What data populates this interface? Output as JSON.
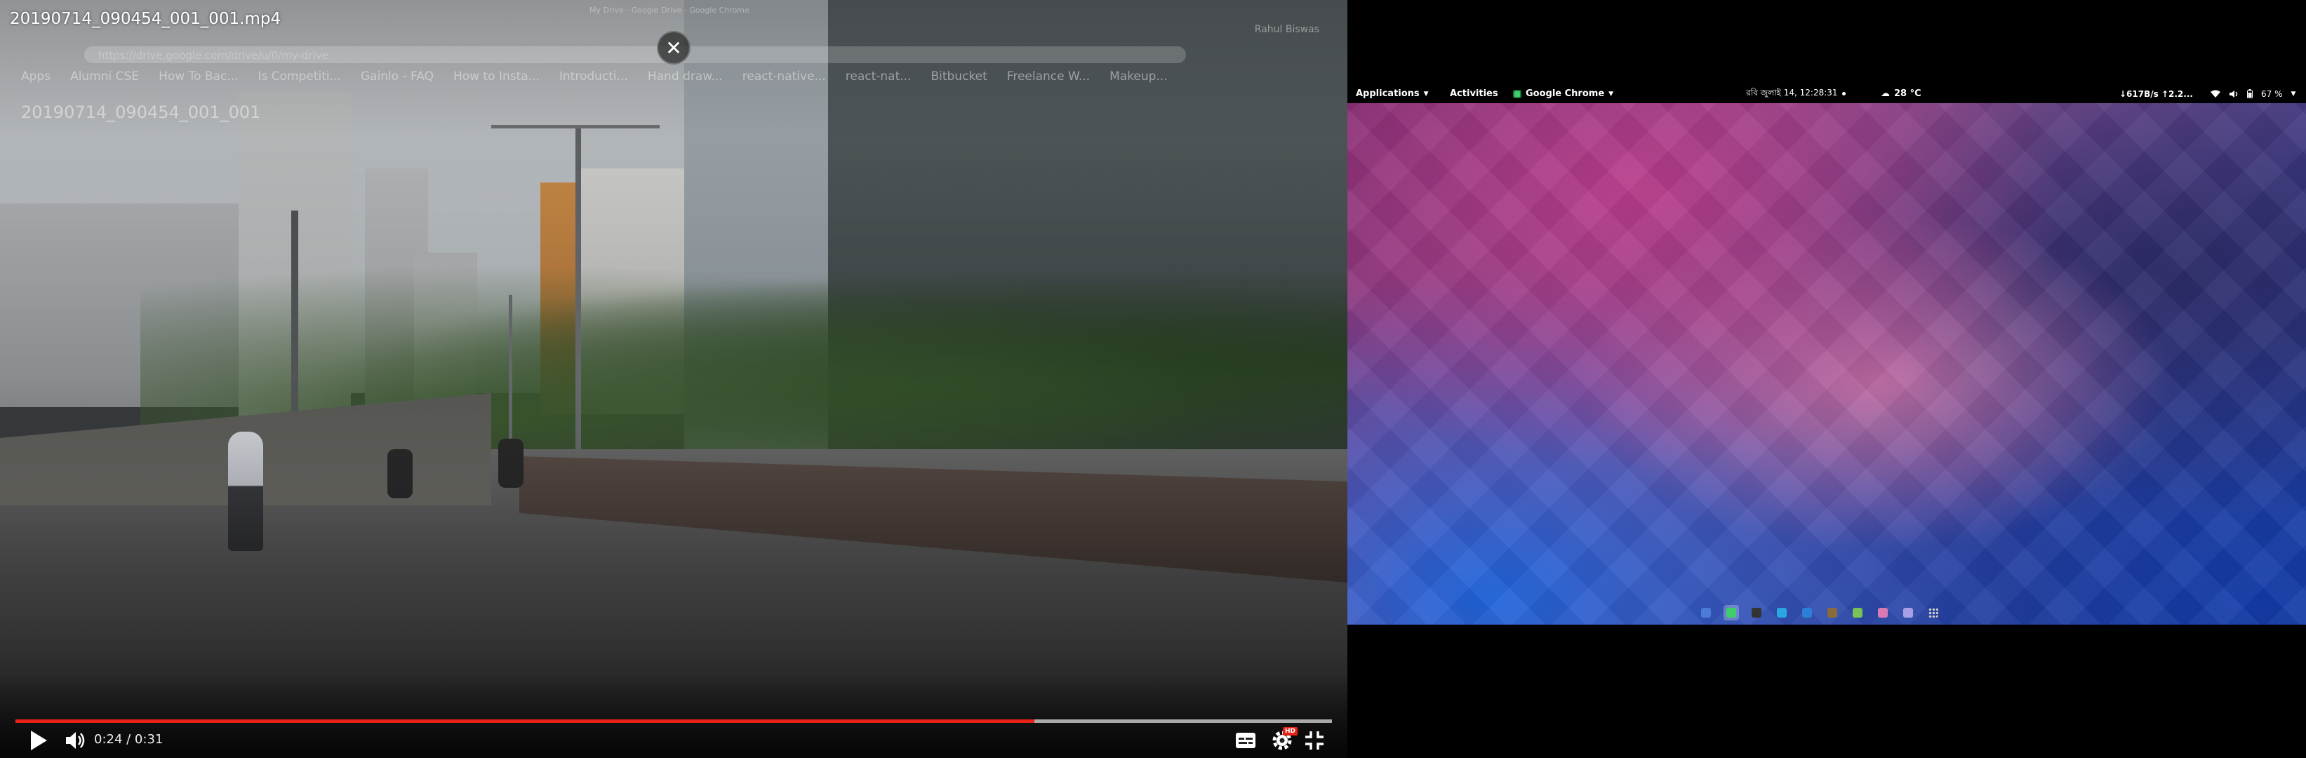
{
  "video_player": {
    "title": "20190714_090454_001_001.mp4",
    "close_glyph": "✕",
    "time_display": "0:24 / 0:31",
    "progress_fraction": 0.7742,
    "buffered_fraction": 1.0,
    "hd_badge": "HD",
    "colors": {
      "progress": "#e62117",
      "track": "rgba(255,255,255,0.35)"
    },
    "icons": [
      "play-icon",
      "volume-icon",
      "captions-icon",
      "settings-icon",
      "exit-fullscreen-icon"
    ]
  },
  "ghost_browser": {
    "tab_text": "My Drive - Google Drive - Google Chrome",
    "user": "Rahul Biswas",
    "url": "https://drive.google.com/drive/u/0/my-drive",
    "bookmarks": [
      "Apps",
      "Alumni CSE",
      "How To Bac...",
      "Is Competiti...",
      "Gainlo - FAQ",
      "How to Insta...",
      "Introducti...",
      "Hand draw...",
      "react-native...",
      "react-nat...",
      "Bitbucket",
      "Freelance W...",
      "Makeup..."
    ],
    "file_label": "20190714_090454_001_001"
  },
  "desktop": {
    "panel": {
      "applications": "Applications",
      "activities": "Activities",
      "active_app": "Google Chrome",
      "clock": "রবি জুলাই 14, 12:28:31",
      "weather": "28 °C",
      "netspeed": "↓617B/s ↑2.2...",
      "battery": "67 %"
    },
    "dock_icons": [
      "files-icon",
      "chrome-icon",
      "terminal-icon",
      "skype-icon",
      "vscode-icon",
      "archive-icon",
      "android-icon",
      "app-icon",
      "text-editor-icon",
      "app-grid-icon"
    ],
    "dock_colors": [
      "#4c7bd9",
      "#3ecf6b",
      "#333333",
      "#2aa6e0",
      "#2b7fd6",
      "#8a6b3a",
      "#78c257",
      "#d97ab4",
      "#a7a0e8",
      "#bbbbbb"
    ],
    "colors": {
      "wallpaper_pink": "#b03c8c",
      "wallpaper_blue": "#1e5fd2",
      "panel": "#000000"
    }
  }
}
